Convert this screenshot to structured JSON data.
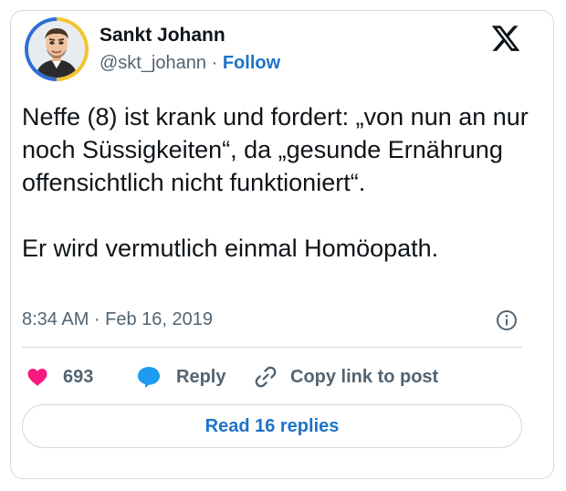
{
  "author": {
    "name": "Sankt Johann",
    "handle": "@skt_johann",
    "separator": "·",
    "follow_label": "Follow"
  },
  "tweet": {
    "text": "Neffe (8) ist krank und fordert: „von nun an nur noch Süssigkeiten“, da „gesunde Ernährung offensichtlich nicht funktioniert“.\n\nEr wird vermutlich einmal Homöopath.",
    "timestamp": "8:34 AM · Feb 16, 2019"
  },
  "actions": {
    "likes_count": "693",
    "reply_label": "Reply",
    "copy_label": "Copy link to post"
  },
  "read_replies_label": "Read 16 replies",
  "colors": {
    "heart": "#f91880",
    "reply_bubble": "#1d9bf0",
    "link_blue": "#1d73c8",
    "muted": "#536471"
  },
  "icons": [
    "x-logo-icon",
    "info-icon",
    "heart-icon",
    "reply-bubble-icon",
    "link-icon"
  ]
}
